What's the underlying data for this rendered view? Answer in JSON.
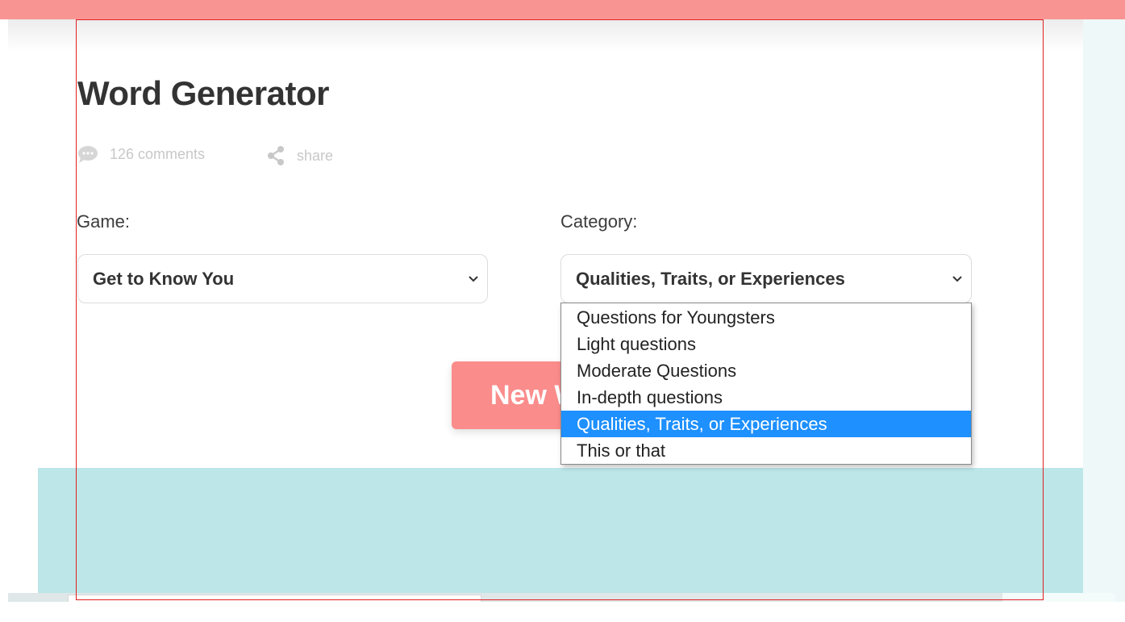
{
  "page": {
    "title": "Word Generator",
    "comments_label": "126 comments",
    "share_label": "share"
  },
  "form": {
    "game_label": "Game:",
    "game_value": "Get to Know You",
    "category_label": "Category:",
    "category_value": "Qualities, Traits, or Experiences",
    "button_label": "New W"
  },
  "category_options": [
    "Questions for Youngsters",
    "Light questions",
    "Moderate Questions",
    "In-depth questions",
    "Qualities, Traits, or Experiences",
    "This or that"
  ],
  "selected_option_index": 4,
  "colors": {
    "top_bar": "#f89593",
    "button": "#fa8c8b",
    "band": "#bce6e8",
    "highlight": "#1e90ff"
  },
  "icons": [
    "comment-icon",
    "share-icon",
    "chevron-down-icon"
  ]
}
